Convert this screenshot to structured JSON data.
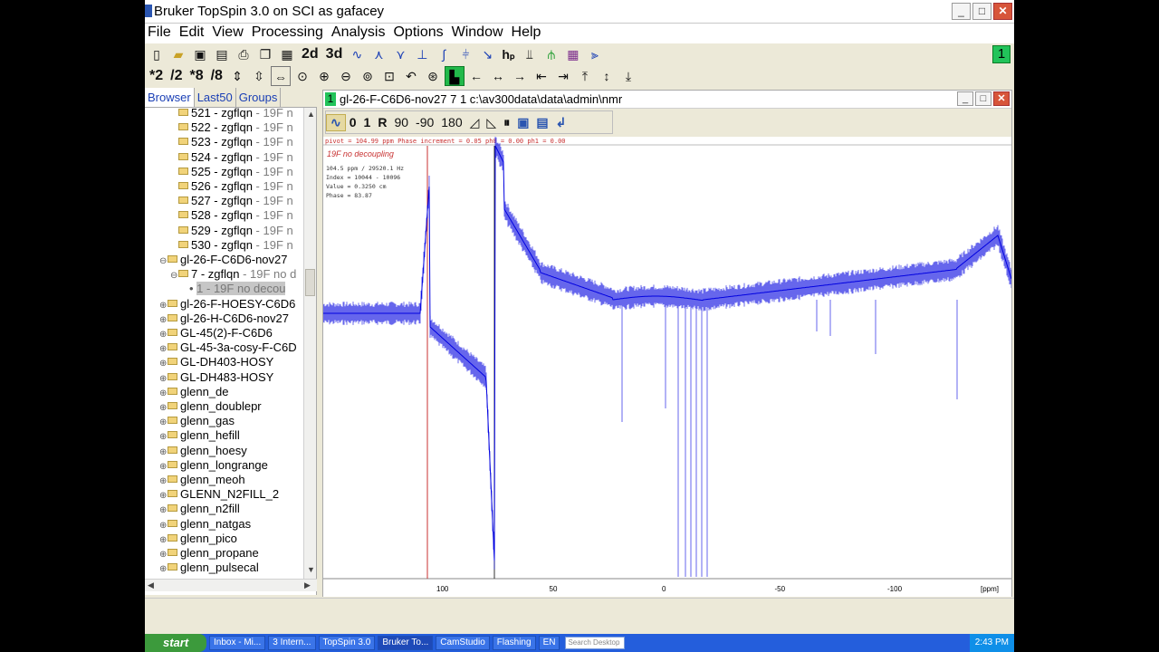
{
  "window": {
    "title": "Bruker TopSpin 3.0 on SCI as gafacey",
    "minimize": "_",
    "maximize": "□",
    "close": "✕"
  },
  "menu": [
    "File",
    "Edit",
    "View",
    "Processing",
    "Analysis",
    "Options",
    "Window",
    "Help"
  ],
  "toolbar1": {
    "twod": "2d",
    "threed": "3d",
    "counter": "1"
  },
  "toolbar2": {
    "mul2": "*2",
    "div2": "/2",
    "mul8": "*8",
    "div8": "/8"
  },
  "panel": {
    "tabs": [
      "Browser",
      "Last50",
      "Groups"
    ],
    "tree": [
      {
        "exp": "",
        "name": "521 - zgflqn",
        "suffix": " - 19F n",
        "indent": 2
      },
      {
        "exp": "",
        "name": "522 - zgflqn",
        "suffix": " - 19F n",
        "indent": 2
      },
      {
        "exp": "",
        "name": "523 - zgflqn",
        "suffix": " - 19F n",
        "indent": 2
      },
      {
        "exp": "",
        "name": "524 - zgflqn",
        "suffix": " - 19F n",
        "indent": 2
      },
      {
        "exp": "",
        "name": "525 - zgflqn",
        "suffix": " - 19F n",
        "indent": 2
      },
      {
        "exp": "",
        "name": "526 - zgflqn",
        "suffix": " - 19F n",
        "indent": 2
      },
      {
        "exp": "",
        "name": "527 - zgflqn",
        "suffix": " - 19F n",
        "indent": 2
      },
      {
        "exp": "",
        "name": "528 - zgflqn",
        "suffix": " - 19F n",
        "indent": 2
      },
      {
        "exp": "",
        "name": "529 - zgflqn",
        "suffix": " - 19F n",
        "indent": 2
      },
      {
        "exp": "",
        "name": "530 - zgflqn",
        "suffix": " - 19F n",
        "indent": 2
      },
      {
        "exp": "⊖",
        "name": "gl-26-F-C6D6-nov27",
        "suffix": "",
        "indent": 1
      },
      {
        "exp": "⊖",
        "name": "7 - zgflqn",
        "suffix": " - 19F no d",
        "indent": 2
      },
      {
        "exp": "",
        "name": "1 - 19F no decou",
        "suffix": "",
        "indent": 3,
        "selected": true
      },
      {
        "exp": "⊕",
        "name": "gl-26-F-HOESY-C6D6",
        "suffix": "",
        "indent": 1
      },
      {
        "exp": "⊕",
        "name": "gl-26-H-C6D6-nov27",
        "suffix": "",
        "indent": 1
      },
      {
        "exp": "⊕",
        "name": "GL-45(2)-F-C6D6",
        "suffix": "",
        "indent": 1
      },
      {
        "exp": "⊕",
        "name": "GL-45-3a-cosy-F-C6D",
        "suffix": "",
        "indent": 1
      },
      {
        "exp": "⊕",
        "name": "GL-DH403-HOSY",
        "suffix": "",
        "indent": 1
      },
      {
        "exp": "⊕",
        "name": "GL-DH483-HOSY",
        "suffix": "",
        "indent": 1
      },
      {
        "exp": "⊕",
        "name": "glenn_de",
        "suffix": "",
        "indent": 1
      },
      {
        "exp": "⊕",
        "name": "glenn_doublepr",
        "suffix": "",
        "indent": 1
      },
      {
        "exp": "⊕",
        "name": "glenn_gas",
        "suffix": "",
        "indent": 1
      },
      {
        "exp": "⊕",
        "name": "glenn_hefill",
        "suffix": "",
        "indent": 1
      },
      {
        "exp": "⊕",
        "name": "glenn_hoesy",
        "suffix": "",
        "indent": 1
      },
      {
        "exp": "⊕",
        "name": "glenn_longrange",
        "suffix": "",
        "indent": 1
      },
      {
        "exp": "⊕",
        "name": "glenn_meoh",
        "suffix": "",
        "indent": 1
      },
      {
        "exp": "⊕",
        "name": "GLENN_N2FILL_2",
        "suffix": "",
        "indent": 1
      },
      {
        "exp": "⊕",
        "name": "glenn_n2fill",
        "suffix": "",
        "indent": 1
      },
      {
        "exp": "⊕",
        "name": "glenn_natgas",
        "suffix": "",
        "indent": 1
      },
      {
        "exp": "⊕",
        "name": "glenn_pico",
        "suffix": "",
        "indent": 1
      },
      {
        "exp": "⊕",
        "name": "glenn_propane",
        "suffix": "",
        "indent": 1
      },
      {
        "exp": "⊕",
        "name": "glenn_pulsecal",
        "suffix": "",
        "indent": 1
      }
    ]
  },
  "spectrum": {
    "window_badge": "1",
    "window_title": "gl-26-F-C6D6-nov27   7  1   c:\\av300data\\data\\admin\\nmr",
    "toolbar": [
      "0",
      "1",
      "R",
      "90",
      "-90",
      "180"
    ],
    "phase_line": "pivot = 104.99 ppm   Phase increment = 0.05   ph0 = 0.00   ph1 = 0.00",
    "label": "19F no decoupling",
    "cursor_info": [
      "104.5 ppm / 29520.1 Hz",
      "Index = 10044 - 10096",
      "Value = 0.3250      cm",
      "Phase = 83.87"
    ],
    "axis_ticks": [
      "100",
      "50",
      "0",
      "-50",
      "-100"
    ],
    "axis_unit": "[ppm]",
    "trace_color": "#0000e0",
    "pivot_color": "#c83232"
  },
  "taskbar": {
    "start": "start",
    "tasks": [
      "Inbox - Mi...",
      "3 Intern...",
      "TopSpin 3.0",
      "Bruker To...",
      "CamStudio",
      "Flashing",
      "EN"
    ],
    "search": "Search Desktop",
    "clock": "2:43 PM"
  }
}
